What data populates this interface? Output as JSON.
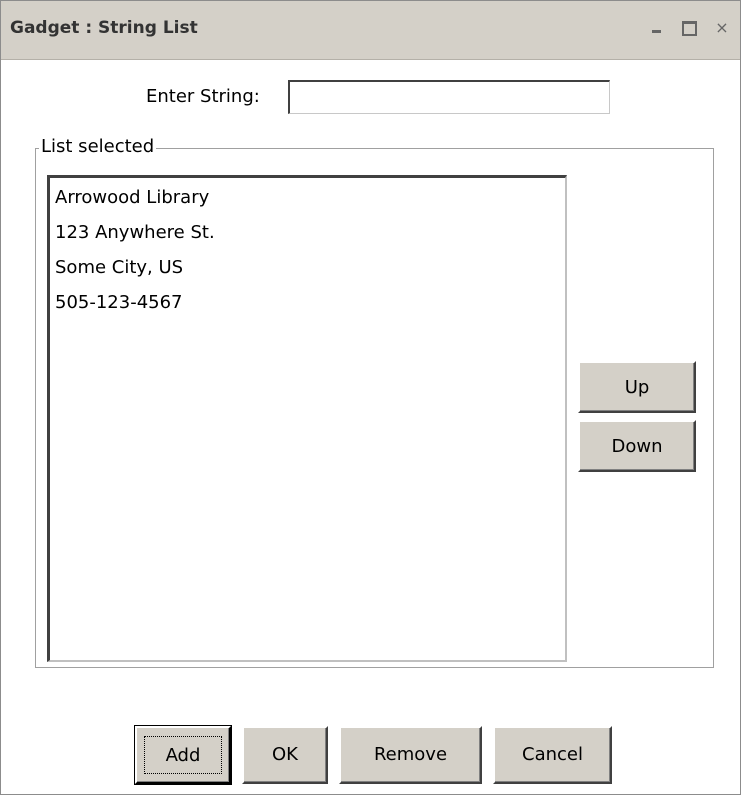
{
  "window": {
    "title": "Gadget : String List",
    "minimize_icon": "minimize-icon",
    "maximize_icon": "maximize-icon",
    "close_icon": "close-icon",
    "close_glyph": "×"
  },
  "form": {
    "enter_string_label": "Enter String:",
    "enter_string_value": ""
  },
  "group": {
    "legend": "List selected",
    "items": [
      "Arrowood Library",
      "123 Anywhere St.",
      "Some City, US",
      "505-123-4567"
    ],
    "up_label": "Up",
    "down_label": "Down"
  },
  "footer": {
    "add_label": "Add",
    "ok_label": "OK",
    "remove_label": "Remove",
    "cancel_label": "Cancel"
  },
  "colors": {
    "titlebar": "#d4d0c8",
    "button_face": "#d4d0c8",
    "background": "#ffffff"
  }
}
